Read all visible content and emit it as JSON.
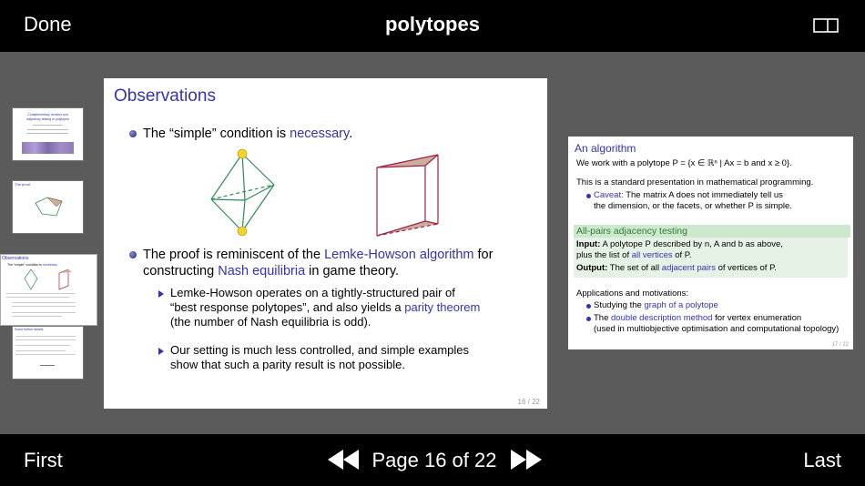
{
  "header": {
    "done": "Done",
    "title": "polytopes",
    "layout_icon": "two-page-layout-icon"
  },
  "footer": {
    "first": "First",
    "page_indicator": "Page 16 of 22",
    "last": "Last",
    "prev_icon": "rewind-icon",
    "next_icon": "fast-forward-icon"
  },
  "thumbnails": {
    "t1_l1": "Complementary vertices and",
    "t1_l2": "adjacency testing in polytopes",
    "t2_title": "The proof",
    "t3_title": "Observations",
    "t3_b1a": "The “simple” condition is",
    "t3_b1b": "necessary.",
    "t4_title": "Some further details"
  },
  "slide": {
    "title": "Observations",
    "b1_prefix": "The “simple” condition is ",
    "b1_link": "necessary",
    "b1_suffix": ".",
    "b2_l1_prefix": "The proof is reminiscent of the ",
    "b2_l1_link": "Lemke-Howson algorithm",
    "b2_l1_suffix": " for",
    "b2_l2_prefix": "constructing ",
    "b2_l2_link": "Nash equilibria",
    "b2_l2_suffix": " in game theory.",
    "s1_l1": "Lemke-Howson operates on a tightly-structured pair of",
    "s1_l2_prefix": "“best response polytopes”, and also yields a ",
    "s1_l2_link": "parity theorem",
    "s1_l3": "(the number of Nash equilibria is odd).",
    "s2_l1": "Our setting is much less controlled, and simple examples",
    "s2_l2": "show that such a parity result is not possible.",
    "page": "16 / 22"
  },
  "slide2": {
    "title": "An algorithm",
    "l1_prefix": "We work with a polytope ",
    "l1_math": "P = {x ∈ ℝⁿ | Ax = b and x ≥ 0}.",
    "l2": "This is a standard presentation in mathematical programming.",
    "c1_link": "Caveat:",
    "c1_rest": " The matrix A does not immediately tell us",
    "c2": "the dimension, or the facets, or whether P is simple.",
    "block_title": "All-pairs adjacency testing",
    "in_label": "Input:",
    "in_l1": " A polytope P described by n, A and b as above,",
    "in_l2_prefix": "plus the list of ",
    "in_l2_link": "all vertices",
    "in_l2_suffix": " of P.",
    "out_label": "Output:",
    "out_prefix": " The set of all ",
    "out_link": "adjacent pairs",
    "out_suffix": " of vertices of P.",
    "apps": "Applications and motivations:",
    "a1_prefix": "Studying the ",
    "a1_link": "graph of a polytope",
    "a2_prefix": "The ",
    "a2_link": "double description method",
    "a2_suffix": " for vertex enumeration",
    "a3": "(used in multiobjective optimisation and computational topology)",
    "page": "17 / 22"
  }
}
